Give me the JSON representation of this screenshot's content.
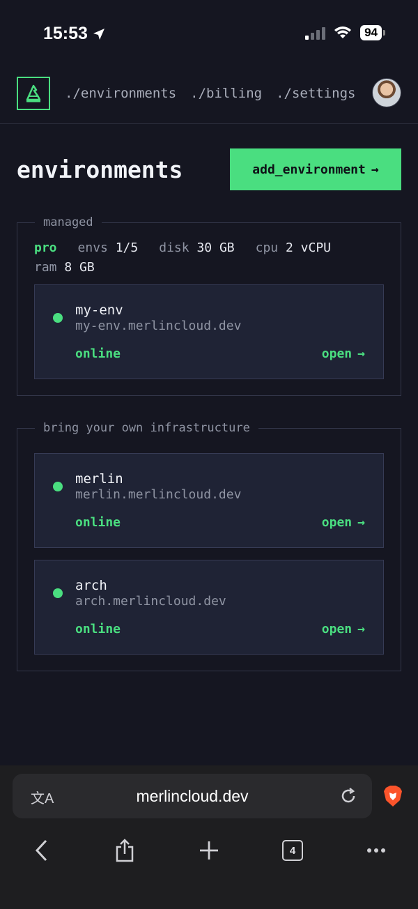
{
  "status_bar": {
    "time": "15:53",
    "battery": "94"
  },
  "nav": {
    "links": [
      "./environments",
      "./billing",
      "./settings"
    ]
  },
  "page": {
    "title": "environments",
    "add_button": "add_environment",
    "arrow": "→"
  },
  "managed": {
    "legend": "managed",
    "plan": "pro",
    "envs_label": "envs",
    "envs_value": "1/5",
    "disk_label": "disk",
    "disk_value": "30 GB",
    "cpu_label": "cpu",
    "cpu_value": "2 vCPU",
    "ram_label": "ram",
    "ram_value": "8 GB",
    "environments": [
      {
        "name": "my-env",
        "host": "my-env.merlincloud.dev",
        "status": "online",
        "action": "open"
      }
    ]
  },
  "byoi": {
    "legend": "bring your own infrastructure",
    "environments": [
      {
        "name": "merlin",
        "host": "merlin.merlincloud.dev",
        "status": "online",
        "action": "open"
      },
      {
        "name": "arch",
        "host": "arch.merlincloud.dev",
        "status": "online",
        "action": "open"
      }
    ]
  },
  "browser": {
    "url": "merlincloud.dev",
    "tab_count": "4",
    "translate_glyph": "文A"
  },
  "colors": {
    "accent": "#4ade80",
    "background": "#151621",
    "card": "#1f2335"
  }
}
